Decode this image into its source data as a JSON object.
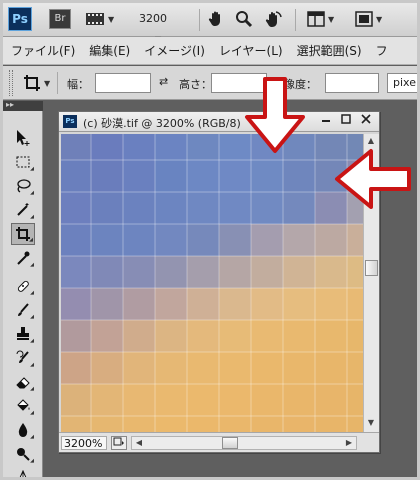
{
  "appbar": {
    "logo": "Ps",
    "bridge": "Br",
    "zoom_value": "3200"
  },
  "menu": {
    "items": [
      "ファイル(F)",
      "編集(E)",
      "イメージ(I)",
      "レイヤー(L)",
      "選択範囲(S)",
      "フ"
    ]
  },
  "options": {
    "width_label": "幅：",
    "height_label": "高さ：",
    "resolution_label": "解像度：",
    "unit_value": "pixel/"
  },
  "document": {
    "logo": "Ps",
    "title": "(c) 砂漠.tif @ 3200% (RGB/8)",
    "zoom_field": "3200%"
  },
  "colors": {
    "accent_arrow": "#c91414",
    "sky": "#5a79b8",
    "sand": "#efbd66"
  },
  "canvas_pixels": [
    [
      "#6f80b9",
      "#6a7cbd",
      "#6a80c0",
      "#6b84c2",
      "#6e88c0",
      "#6e8ac5",
      "#7088c2",
      "#7088bd",
      "#7387b6",
      "#7288b5"
    ],
    [
      "#6a7fbd",
      "#6a7dbc",
      "#6a80bf",
      "#6984c1",
      "#6d88c4",
      "#6f89c5",
      "#6f8ac3",
      "#6f86bd",
      "#7487b8",
      "#8a8bb1"
    ],
    [
      "#6d7fbe",
      "#6b80bd",
      "#6b82bf",
      "#6c85c1",
      "#6f88c2",
      "#7089c3",
      "#718ac2",
      "#7489bd",
      "#8b8db3",
      "#a3a0b0"
    ],
    [
      "#6c81be",
      "#6c84bf",
      "#6d85c0",
      "#7288c0",
      "#7689bb",
      "#8890b4",
      "#a49daf",
      "#b4a7aa",
      "#bca9a2",
      "#c9af9a"
    ],
    [
      "#7b88bd",
      "#8089b7",
      "#878db5",
      "#9394b0",
      "#a59eac",
      "#b5a6a5",
      "#c2ad9e",
      "#d0b495",
      "#d9b98c",
      "#ddbb84"
    ],
    [
      "#948db0",
      "#a095a9",
      "#b09ca2",
      "#c1a69d",
      "#cfb096",
      "#dab88e",
      "#e2bb86",
      "#e6bd7f",
      "#e8bc79",
      "#e8ba74"
    ],
    [
      "#b19a9d",
      "#c2a296",
      "#d0ac8c",
      "#dcb583",
      "#e4b97c",
      "#e7bb77",
      "#e9ba72",
      "#e9b96f",
      "#e8b86d",
      "#e7b76b"
    ],
    [
      "#cda487",
      "#d8ad80",
      "#e1b57a",
      "#e6b874",
      "#e9b970",
      "#eab96e",
      "#eab86c",
      "#e9b76b",
      "#e8b66a",
      "#e7b66a"
    ],
    [
      "#dcb27a",
      "#e3b676",
      "#e8b872",
      "#eab96f",
      "#ebb96d",
      "#ebb86c",
      "#eab76b",
      "#e9b66a",
      "#e8b56a",
      "#e7b569"
    ],
    [
      "#e2b574",
      "#e6b770",
      "#e9b86e",
      "#ebb96c",
      "#ebb86b",
      "#eab76b",
      "#e9b66a",
      "#e9b56a",
      "#e8b569",
      "#e7b569"
    ]
  ]
}
